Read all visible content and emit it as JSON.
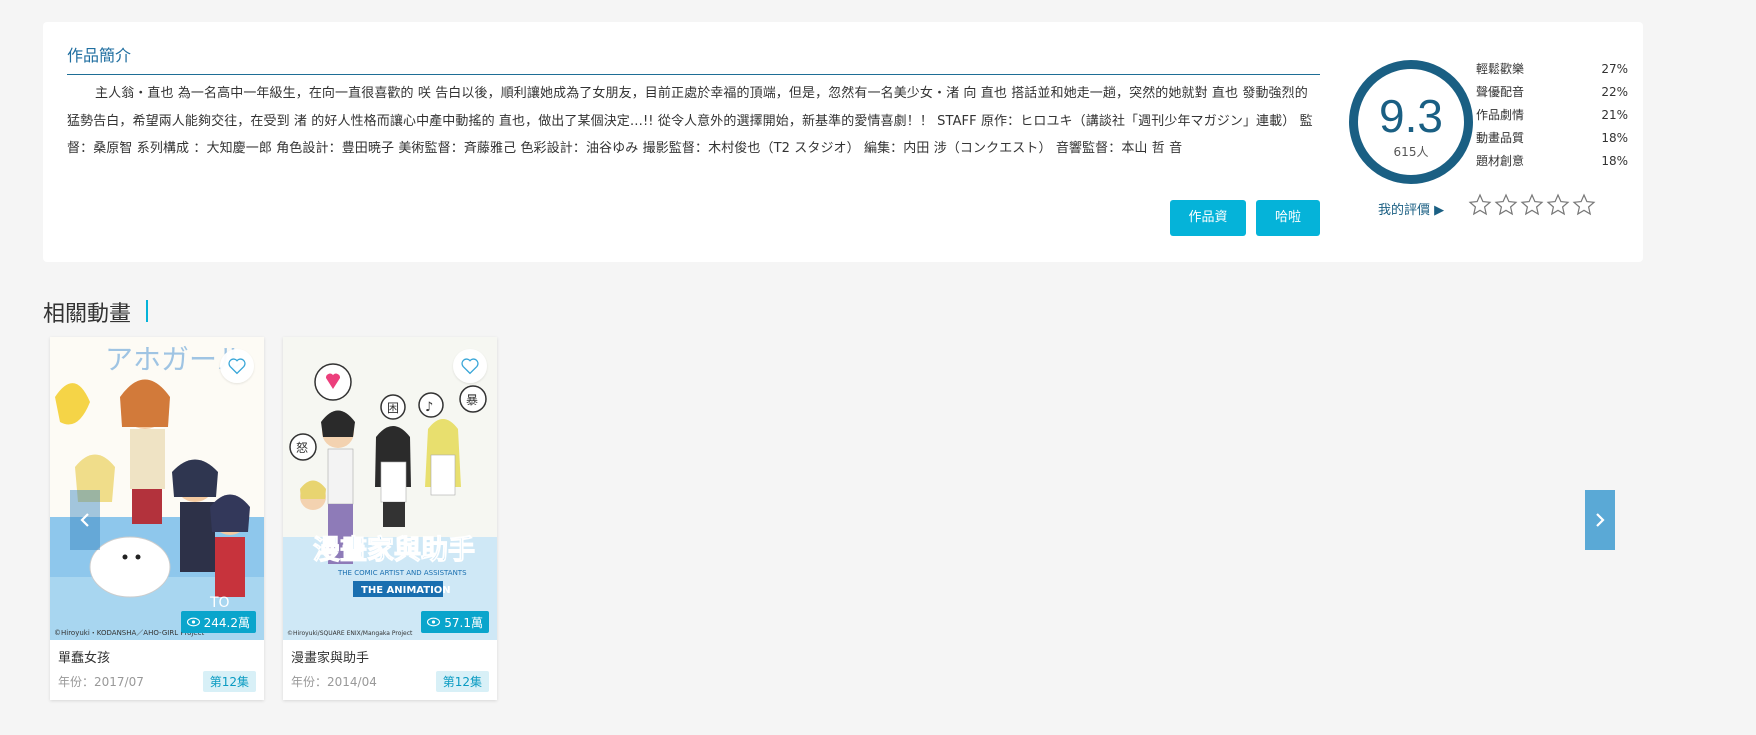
{
  "intro": {
    "title": "作品簡介",
    "text": "主人翁・直也 為一名高中一年級生，在向一直很喜歡的 咲 告白以後，順利讓她成為了女朋友，目前正處於幸福的頂端，但是，忽然有一名美少女・渚 向 直也 搭話並和她走一趟，突然的她就對 直也 發動強烈的猛勢告白，希望兩人能夠交往，在受到 渚 的好人性格而讓心中產中動搖的 直也，做出了某個決定…!! 從令人意外的選擇開始，新基準的愛情喜劇！！ STAFF 原作：ヒロユキ（講談社「週刊少年マガジン」連載） 監督：桑原智 系列構成 ：大知慶一郎 角色設計：豊田暁子 美術監督：斉藤雅己 色彩設計：油谷ゆみ 撮影監督：木村俊也（T2 スタジオ） 編集：内田 涉（コンクエスト） 音響監督：本山 哲 音",
    "btn_info": "作品資料",
    "btn_board": "哈啦板"
  },
  "score": {
    "value": "9.3",
    "count": "615人",
    "categories": [
      {
        "label": "輕鬆歡樂",
        "percent": "27%"
      },
      {
        "label": "聲優配音",
        "percent": "22%"
      },
      {
        "label": "作品劇情",
        "percent": "21%"
      },
      {
        "label": "動畫品質",
        "percent": "18%"
      },
      {
        "label": "題材創意",
        "percent": "18%"
      }
    ],
    "my_rating_label": "我的評價 ▶",
    "stars": 0
  },
  "related": {
    "title": "相關動畫",
    "items": [
      {
        "name": "單蠢女孩",
        "year": "年份：2017/07",
        "episodes": "第12集",
        "views": "244.2萬",
        "cover_text": "アホガール",
        "copyright": "©Hiroyuki・KODANSHA／AHO-GIRL Project"
      },
      {
        "name": "漫畫家與助手",
        "year": "年份：2014/04",
        "episodes": "第12集",
        "views": "57.1萬",
        "cover_text": "漫畫家與助手",
        "cover_sub": "THE COMIC ARTIST AND ASSISTANTS",
        "cover_sub2": "THE ANIMATION",
        "copyright": "©Hiroyuki/SQUARE ENIX/Mangaka Project"
      }
    ]
  },
  "colors": {
    "accent": "#05b3d9",
    "score_ring": "#1a5f83",
    "views_badge": "#0aa5cc"
  }
}
